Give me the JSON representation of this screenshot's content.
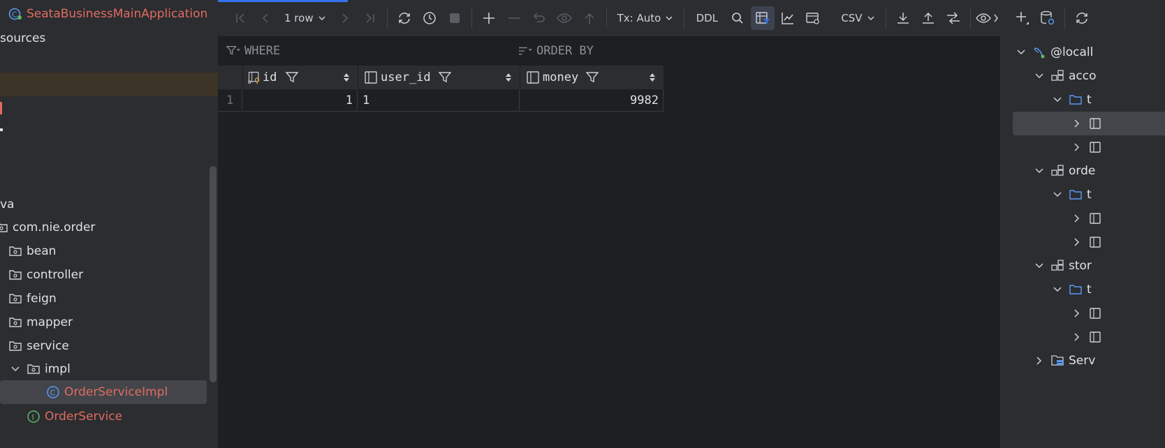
{
  "project_tree": {
    "items": [
      {
        "label": "SeataBusinessMainApplication",
        "icon": "spring-boot-icon",
        "style": "red"
      },
      {
        "label": "sources",
        "icon": "",
        "style": "normal"
      },
      {
        "label": "",
        "icon": "",
        "style": "normal"
      },
      {
        "label": "",
        "icon": "",
        "style": "highlight"
      },
      {
        "label": "",
        "icon": "",
        "style": "normal"
      },
      {
        "label": "",
        "icon": "",
        "style": "normal"
      },
      {
        "label": "",
        "icon": "",
        "style": "normal"
      },
      {
        "label": "",
        "icon": "",
        "style": "normal"
      },
      {
        "label": "va",
        "icon": "",
        "style": "normal"
      },
      {
        "label": "com.nie.order",
        "icon": "package-icon",
        "style": "normal"
      },
      {
        "label": "bean",
        "icon": "package-icon",
        "style": "normal"
      },
      {
        "label": "controller",
        "icon": "package-icon",
        "style": "normal"
      },
      {
        "label": "feign",
        "icon": "package-icon",
        "style": "normal"
      },
      {
        "label": "mapper",
        "icon": "package-icon",
        "style": "normal"
      },
      {
        "label": "service",
        "icon": "package-icon",
        "style": "normal"
      },
      {
        "label": "impl",
        "icon": "package-icon",
        "style": "normal"
      },
      {
        "label": "OrderServiceImpl",
        "icon": "class-icon",
        "style": "red-selected"
      },
      {
        "label": "OrderService",
        "icon": "interface-icon",
        "style": "red"
      }
    ]
  },
  "toolbar": {
    "row_count": "1 row",
    "tx_mode": "Tx: Auto",
    "ddl_label": "DDL",
    "export_format": "CSV"
  },
  "filter": {
    "where_label": "WHERE",
    "order_by_label": "ORDER BY"
  },
  "grid": {
    "columns": [
      {
        "name": "id",
        "icon": "primary-key-column-icon"
      },
      {
        "name": "user_id",
        "icon": "column-icon"
      },
      {
        "name": "money",
        "icon": "column-icon"
      }
    ],
    "rows": [
      {
        "row_number": "1",
        "cells": [
          "1",
          "1",
          "9982"
        ]
      }
    ]
  },
  "db_tree": {
    "items": [
      {
        "label": "@locall",
        "icon": "mysql-datasource-icon"
      },
      {
        "label": "acco",
        "icon": "schema-icon"
      },
      {
        "label": "t",
        "icon": "folder-icon"
      },
      {
        "label": "",
        "icon": "table-icon"
      },
      {
        "label": "",
        "icon": "table-icon"
      },
      {
        "label": "orde",
        "icon": "schema-icon"
      },
      {
        "label": "t",
        "icon": "folder-icon"
      },
      {
        "label": "",
        "icon": "table-icon"
      },
      {
        "label": "",
        "icon": "table-icon"
      },
      {
        "label": "stor",
        "icon": "schema-icon"
      },
      {
        "label": "t",
        "icon": "folder-icon"
      },
      {
        "label": "",
        "icon": "table-icon"
      },
      {
        "label": "",
        "icon": "table-icon"
      },
      {
        "label": "Serv",
        "icon": "server-objects-icon"
      }
    ]
  },
  "colors": {
    "accent": "#3574f0",
    "error_red": "#e06c60",
    "panel_bg": "#2b2d30",
    "editor_bg": "#1e1f22"
  }
}
